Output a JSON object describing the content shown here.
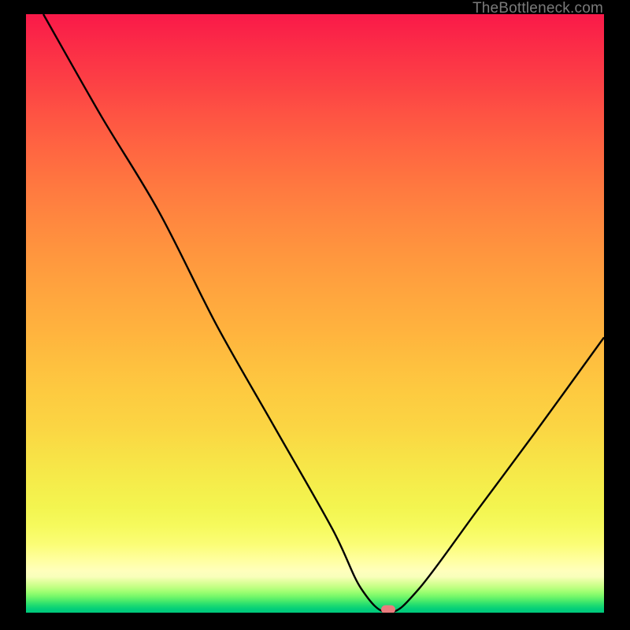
{
  "watermark": "TheBottleneck.com",
  "marker": {
    "x_pct": 62.7,
    "y_pct": 99.5
  },
  "colors": {
    "marker": "#EA7C7E"
  },
  "chart_data": {
    "type": "line",
    "title": "",
    "xlabel": "",
    "ylabel": "",
    "xlim": [
      0,
      100
    ],
    "ylim": [
      0,
      100
    ],
    "grid": false,
    "legend": false,
    "series": [
      {
        "name": "bottleneck-curve",
        "x": [
          3,
          13,
          23,
          33,
          43,
          53,
          58,
          62.7,
          68,
          78,
          88,
          100
        ],
        "y": [
          100,
          83,
          67,
          48,
          31,
          14,
          4,
          0,
          4,
          17,
          30,
          46
        ]
      }
    ],
    "background_gradient": [
      [
        "0%",
        "#F91949"
      ],
      [
        "50%",
        "#FFAA3E"
      ],
      [
        "80%",
        "#F5ED4B"
      ],
      [
        "93%",
        "#FFFFBC"
      ],
      [
        "100%",
        "#00CA7C"
      ]
    ]
  }
}
